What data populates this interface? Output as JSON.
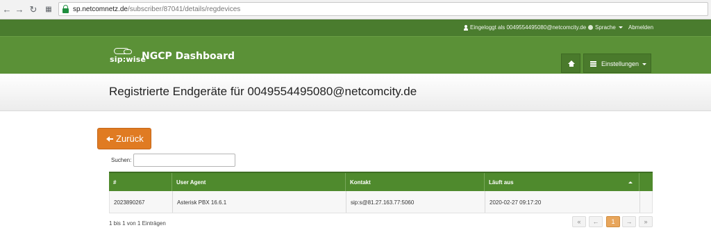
{
  "browser": {
    "url_domain": "sp.netcomnetz.de",
    "url_path": "/subscriber/87041/details/regdevices"
  },
  "topbar": {
    "logged_in": "Eingeloggt als 0049554495080@netcomcity.de",
    "language": "Sprache",
    "logout": "Abmelden"
  },
  "header": {
    "logo_word": "sip:wise",
    "brand": "NGCP Dashboard",
    "settings": "Einstellungen"
  },
  "page": {
    "title": "Registrierte Endgeräte für 0049554495080@netcomcity.de",
    "back": "Zurück",
    "search_label": "Suchen:",
    "search_value": ""
  },
  "table": {
    "columns": [
      "#",
      "User Agent",
      "Kontakt",
      "Läuft aus"
    ],
    "rows": [
      [
        "2023890267",
        "Asterisk PBX 16.6.1",
        "sip:s@81.27.163.77:5060",
        "2020-02-27 09:17:20"
      ]
    ]
  },
  "footer": {
    "info": "1 bis 1 von 1 Einträgen",
    "pager": [
      "«",
      "←",
      "1",
      "→",
      "»"
    ]
  },
  "colors": {
    "topbar": "#4a7c2e",
    "header": "#5b9137",
    "accent_orange": "#e07b22"
  }
}
